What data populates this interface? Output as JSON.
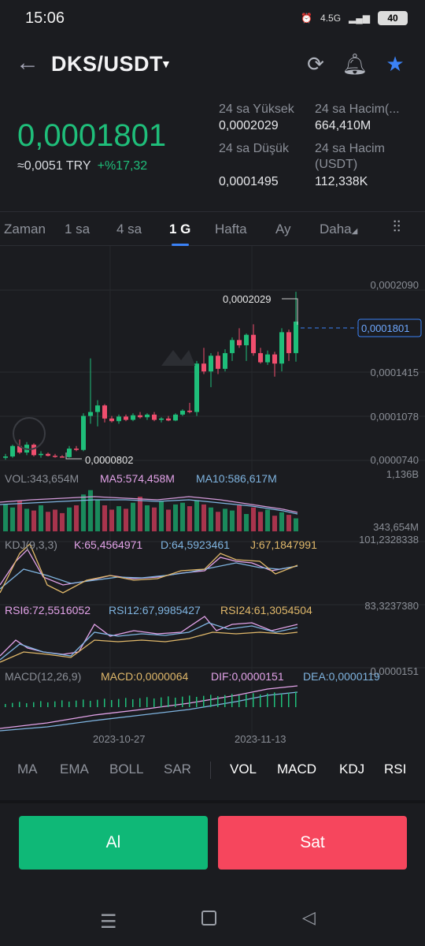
{
  "status_bar": {
    "time": "15:06",
    "network": "4.5G",
    "battery": "40"
  },
  "header": {
    "pair": "DKS/USDT"
  },
  "ticker": {
    "last_price": "0,0001801",
    "try_price": "≈0,0051 TRY",
    "change": "+%17,32",
    "high_label": "24 sa Yüksek",
    "high_value": "0,0002029",
    "low_label": "24 sa Düşük",
    "low_value": "0,0001495",
    "vol_label": "24 sa Hacim(...",
    "vol_value": "664,410M",
    "vol_usdt_label_1": "24 sa Hacim",
    "vol_usdt_label_2": "(USDT)",
    "vol_usdt_value": "112,338K"
  },
  "interval_tabs": [
    "Zaman",
    "1 sa",
    "4 sa",
    "1 G",
    "Hafta",
    "Ay",
    "Daha"
  ],
  "active_interval": "1 G",
  "price_axis": [
    "0,0002090",
    "0,0001415",
    "0,0001078",
    "0,0000740"
  ],
  "current_price_tag": "0,0001801",
  "annot_high": "0,0002029",
  "annot_low": "0,0000802",
  "volume": {
    "label": "VOL:343,654M",
    "ma5": "MA5:574,458M",
    "ma10": "MA10:586,617M",
    "axis_top": "1,136B",
    "axis_bottom": "343,654M"
  },
  "kdj": {
    "label": "KDJ(9,3,3)",
    "k": "K:65,4564971",
    "d": "D:64,5923461",
    "j": "J:67,1847991",
    "axis_top": "101,2328338"
  },
  "rsi": {
    "r6": "RSI6:72,5516052",
    "r12": "RSI12:67,9985427",
    "r24": "RSI24:61,3054504",
    "axis_top": "83,3237380"
  },
  "macd": {
    "label": "MACD(12,26,9)",
    "macd": "MACD:0,0000064",
    "dif": "DIF:0,0000151",
    "dea": "DEA:0,0000119",
    "axis_top": "0,0000151"
  },
  "dates": [
    "2023-10-27",
    "2023-11-13"
  ],
  "indicator_tabs_left": [
    "MA",
    "EMA",
    "BOLL",
    "SAR"
  ],
  "indicator_tabs_right": [
    "VOL",
    "MACD",
    "KDJ",
    "RSI"
  ],
  "buttons": {
    "buy": "Al",
    "sell": "Sat"
  },
  "colors": {
    "up": "#1fbe7a",
    "down": "#f04e6e",
    "accent": "#3b82f6",
    "buy": "#0fb877",
    "sell": "#f6465d"
  },
  "chart_data": {
    "type": "candlestick",
    "ohlc": [
      {
        "o": 7.6e-05,
        "h": 7.9e-05,
        "l": 7.45e-05,
        "c": 7.7e-05
      },
      {
        "o": 7.7e-05,
        "h": 8.6e-05,
        "l": 7.6e-05,
        "c": 8.5e-05
      },
      {
        "o": 8.5e-05,
        "h": 9e-05,
        "l": 7.9e-05,
        "c": 8e-05
      },
      {
        "o": 8e-05,
        "h": 8.8e-05,
        "l": 7.8e-05,
        "c": 8.6e-05
      },
      {
        "o": 8.6e-05,
        "h": 8.7e-05,
        "l": 7.7e-05,
        "c": 7.8e-05
      },
      {
        "o": 7.8e-05,
        "h": 8.1e-05,
        "l": 7.6e-05,
        "c": 7.9e-05
      },
      {
        "o": 7.9e-05,
        "h": 8e-05,
        "l": 7.7e-05,
        "c": 7.75e-05
      },
      {
        "o": 7.75e-05,
        "h": 7.9e-05,
        "l": 7.6e-05,
        "c": 7.7e-05
      },
      {
        "o": 7.7e-05,
        "h": 7.8e-05,
        "l": 8.02e-05,
        "c": 7.65e-05
      },
      {
        "o": 7.65e-05,
        "h": 8.5e-05,
        "l": 7.6e-05,
        "c": 8.3e-05
      },
      {
        "o": 8.3e-05,
        "h": 8.5e-05,
        "l": 8.1e-05,
        "c": 8.2e-05
      },
      {
        "o": 8.2e-05,
        "h": 0.00011,
        "l": 8.1e-05,
        "c": 0.000108
      },
      {
        "o": 0.000108,
        "h": 0.000152,
        "l": 0.000102,
        "c": 0.000111
      },
      {
        "o": 0.000111,
        "h": 0.00012,
        "l": 0.0001,
        "c": 0.000116
      },
      {
        "o": 0.000116,
        "h": 0.000117,
        "l": 0.000103,
        "c": 0.000106
      },
      {
        "o": 0.000106,
        "h": 0.000108,
        "l": 0.000103,
        "c": 0.000104
      },
      {
        "o": 0.000104,
        "h": 0.000109,
        "l": 0.000102,
        "c": 0.0001075
      },
      {
        "o": 0.0001075,
        "h": 0.000109,
        "l": 0.000104,
        "c": 0.000105
      },
      {
        "o": 0.000105,
        "h": 0.00011,
        "l": 0.000104,
        "c": 0.0001085
      },
      {
        "o": 0.0001085,
        "h": 0.000111,
        "l": 0.000106,
        "c": 0.000107
      },
      {
        "o": 0.000107,
        "h": 0.00011,
        "l": 0.000105,
        "c": 0.000109
      },
      {
        "o": 0.000109,
        "h": 0.000111,
        "l": 0.000104,
        "c": 0.000105
      },
      {
        "o": 0.000105,
        "h": 0.000107,
        "l": 0.000103,
        "c": 0.000106
      },
      {
        "o": 0.000106,
        "h": 0.000108,
        "l": 0.000104,
        "c": 0.0001045
      },
      {
        "o": 0.0001045,
        "h": 0.00011,
        "l": 0.000104,
        "c": 0.000109
      },
      {
        "o": 0.000109,
        "h": 0.000113,
        "l": 0.000108,
        "c": 0.000112
      },
      {
        "o": 0.000112,
        "h": 0.000118,
        "l": 0.00011,
        "c": 0.000111
      },
      {
        "o": 0.000111,
        "h": 0.00015,
        "l": 0.000108,
        "c": 0.000148
      },
      {
        "o": 0.000148,
        "h": 0.00016,
        "l": 0.00014,
        "c": 0.000142
      },
      {
        "o": 0.000142,
        "h": 0.000156,
        "l": 0.00013,
        "c": 0.000154
      },
      {
        "o": 0.000154,
        "h": 0.000157,
        "l": 0.00014,
        "c": 0.000144
      },
      {
        "o": 0.000144,
        "h": 0.000159,
        "l": 0.000142,
        "c": 0.000156
      },
      {
        "o": 0.000156,
        "h": 0.000168,
        "l": 0.00015,
        "c": 0.000166
      },
      {
        "o": 0.000166,
        "h": 0.000175,
        "l": 0.00016,
        "c": 0.000162
      },
      {
        "o": 0.000162,
        "h": 0.000171,
        "l": 0.00015,
        "c": 0.00017
      },
      {
        "o": 0.00017,
        "h": 0.000178,
        "l": 0.000154,
        "c": 0.000156
      },
      {
        "o": 0.000156,
        "h": 0.00016,
        "l": 0.000148,
        "c": 0.000149
      },
      {
        "o": 0.000149,
        "h": 0.000158,
        "l": 0.000147,
        "c": 0.000155
      },
      {
        "o": 0.000155,
        "h": 0.000157,
        "l": 0.000138,
        "c": 0.000148
      },
      {
        "o": 0.000148,
        "h": 0.000175,
        "l": 0.000142,
        "c": 0.000172
      },
      {
        "o": 0.000172,
        "h": 0.000174,
        "l": 0.00015,
        "c": 0.000156
      },
      {
        "o": 0.000156,
        "h": 0.0002029,
        "l": 0.0001495,
        "c": 0.0001801
      }
    ],
    "volume": [
      0.62,
      0.55,
      0.7,
      0.52,
      0.48,
      0.6,
      0.45,
      0.5,
      0.42,
      0.55,
      0.6,
      0.85,
      0.95,
      0.72,
      0.6,
      0.5,
      0.58,
      0.52,
      0.66,
      0.8,
      0.6,
      0.55,
      0.7,
      0.5,
      0.62,
      0.66,
      0.58,
      0.72,
      0.62,
      0.55,
      0.45,
      0.52,
      0.48,
      0.6,
      0.4,
      0.55,
      0.45,
      0.5,
      0.36,
      0.44,
      0.38,
      0.3
    ],
    "y_range": [
      7.4e-05,
      0.000209
    ],
    "x_labels": [
      "2023-10-27",
      "2023-11-13"
    ]
  }
}
